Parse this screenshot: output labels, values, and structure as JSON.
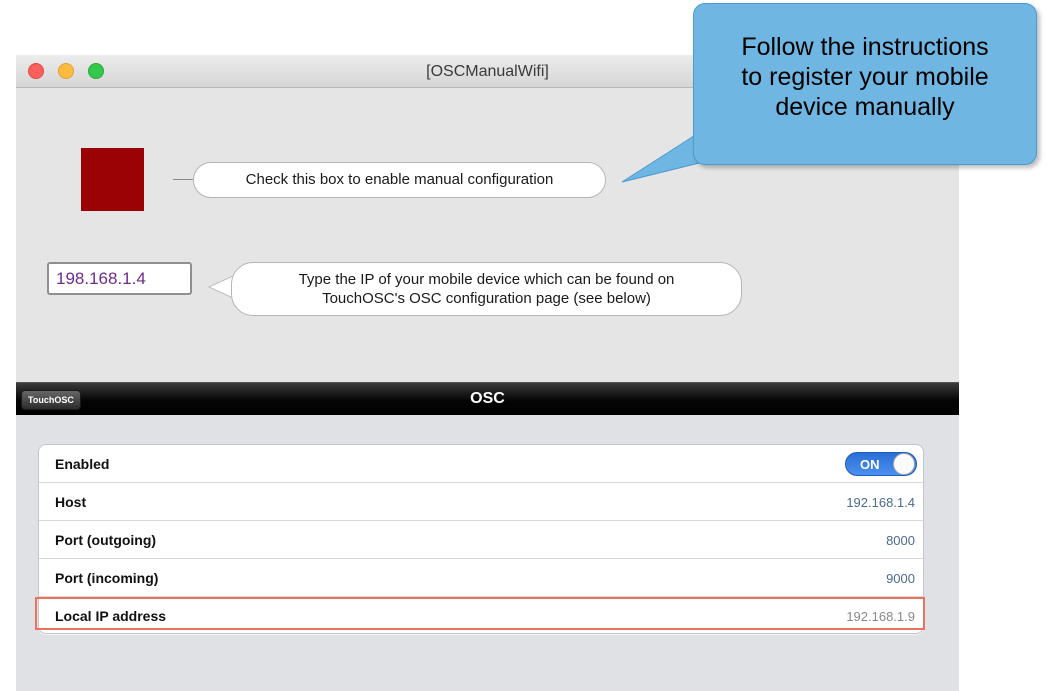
{
  "window": {
    "title": "[OSCManualWifi]"
  },
  "manual": {
    "checkbox_hint": "Check this box to enable manual configuration",
    "ip_value": "198.168.1.4",
    "ip_hint_line1": "Type the IP of your mobile device which can be found on",
    "ip_hint_line2": "TouchOSC's OSC configuration page (see below)",
    "checkbox_color": "#9b0206"
  },
  "instructions": {
    "line1": "Follow the instructions",
    "line2": "to register your mobile",
    "line3": "device manually",
    "color": "#6fb6e2"
  },
  "touchosc": {
    "back_label": "TouchOSC",
    "title": "OSC",
    "rows": [
      {
        "label": "Enabled",
        "toggle": "ON"
      },
      {
        "label": "Host",
        "value": "192.168.1.4"
      },
      {
        "label": "Port (outgoing)",
        "value": "8000"
      },
      {
        "label": "Port (incoming)",
        "value": "9000"
      },
      {
        "label": "Local IP address",
        "value": "192.168.1.9"
      }
    ],
    "accent": "#2b6fd6",
    "highlight_color": "#e8735f"
  }
}
